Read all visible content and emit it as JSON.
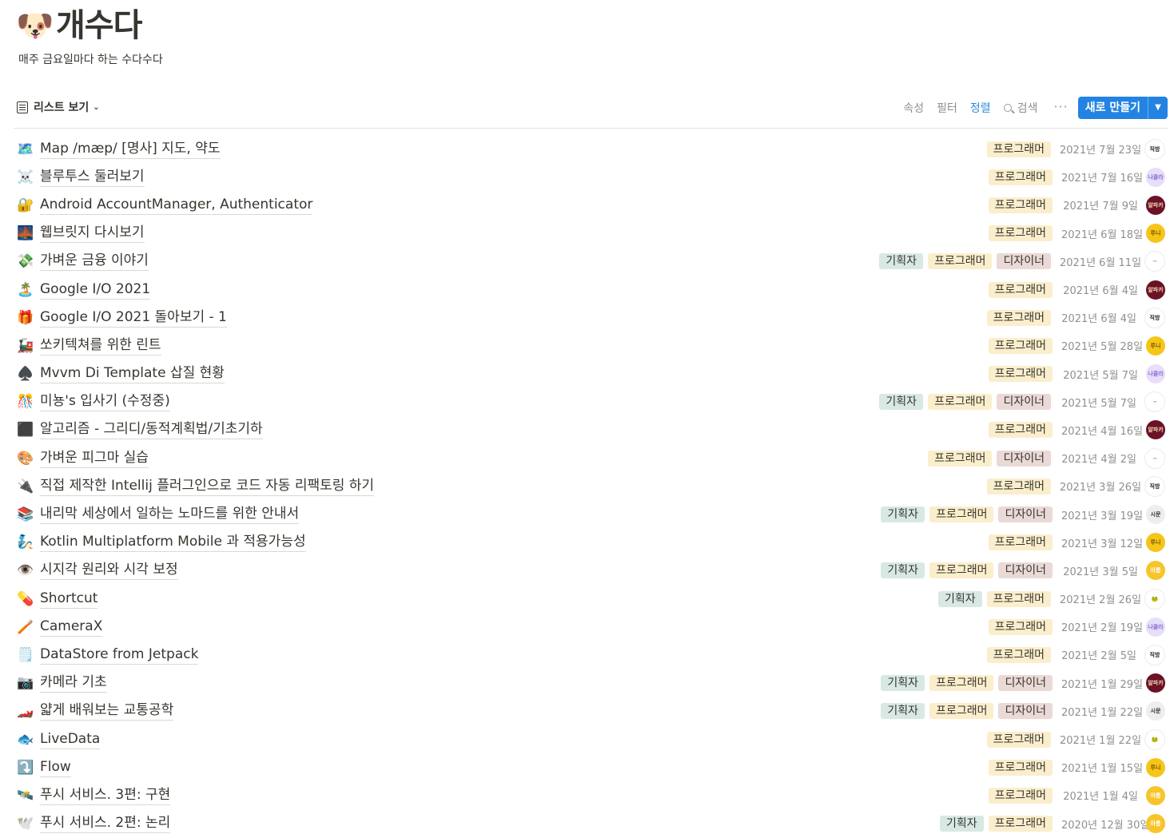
{
  "page": {
    "emoji": "🐶",
    "title": "개수다",
    "description": "매주 금요일마다 하는 수다수다"
  },
  "toolbar": {
    "view_label": "리스트 보기",
    "properties": "속성",
    "filter": "필터",
    "sort": "정렬",
    "search": "검색",
    "more": "···",
    "new_button": "새로 만들기",
    "new_dropdown": "▼"
  },
  "colors": {
    "planner": "#d8e9e4",
    "programmer": "#fbeecc",
    "designer": "#ead9d6",
    "accent": "#2383e2",
    "active_tool": "#2e8ad8"
  },
  "tag_labels": {
    "planner": "기획자",
    "programmer": "프로그래머",
    "designer": "디자이너"
  },
  "avatars": {
    "zig": {
      "label": "직방",
      "bg": "#ffffff",
      "fg": "#222222"
    },
    "na": {
      "label": "나클라",
      "bg": "#e7defa",
      "fg": "#8a6fd1"
    },
    "al": {
      "label": "알파카",
      "bg": "#6b1226",
      "fg": "#f3d9b5"
    },
    "ru": {
      "label": "루니",
      "bg": "#f5c518",
      "fg": "#7a5a00"
    },
    "sw": {
      "label": "~",
      "bg": "#ffffff",
      "fg": "#4a9bd6"
    },
    "si": {
      "label": "시문",
      "bg": "#eeeeee",
      "fg": "#333333"
    },
    "ar": {
      "label": "아름",
      "bg": "#f7c52b",
      "fg": "#ffffff"
    },
    "gr": {
      "label": "🐸",
      "bg": "#ffffff",
      "fg": "#5a8a2b"
    }
  },
  "rows": [
    {
      "icon": "🗺️",
      "title": "Map /mæp/ [명사] 지도, 약도",
      "tags": [
        "programmer"
      ],
      "date": "2021년 7월 23일",
      "avatar": "zig"
    },
    {
      "icon": "☠️",
      "title": "블루투스 둘러보기",
      "tags": [
        "programmer"
      ],
      "date": "2021년 7월 16일",
      "avatar": "na"
    },
    {
      "icon": "🔐",
      "title": "Android AccountManager, Authenticator",
      "tags": [
        "programmer"
      ],
      "date": "2021년 7월 9일",
      "avatar": "al"
    },
    {
      "icon": "🌉",
      "title": "웹브릿지 다시보기",
      "tags": [
        "programmer"
      ],
      "date": "2021년 6월 18일",
      "avatar": "ru"
    },
    {
      "icon": "💸",
      "title": "가벼운 금융 이야기",
      "tags": [
        "planner",
        "programmer",
        "designer"
      ],
      "date": "2021년 6월 11일",
      "avatar": "sw"
    },
    {
      "icon": "🏝️",
      "title": "Google I/O 2021",
      "tags": [
        "programmer"
      ],
      "date": "2021년 6월 4일",
      "avatar": "al"
    },
    {
      "icon": "🎁",
      "title": "Google I/O 2021 돌아보기 - 1",
      "tags": [
        "programmer"
      ],
      "date": "2021년 6월 4일",
      "avatar": "zig"
    },
    {
      "icon": "🚂",
      "title": "쏘키텍쳐를 위한 린트",
      "tags": [
        "programmer"
      ],
      "date": "2021년 5월 28일",
      "avatar": "ru"
    },
    {
      "icon": "♠️",
      "title": "Mvvm Di Template 삽질 현황",
      "tags": [
        "programmer"
      ],
      "date": "2021년 5월 7일",
      "avatar": "na"
    },
    {
      "icon": "🎊",
      "title": "미뇽's 입사기 (수정중)",
      "tags": [
        "planner",
        "programmer",
        "designer"
      ],
      "date": "2021년 5월 7일",
      "avatar": "sw"
    },
    {
      "icon": "⬛",
      "title": "알고리즘 - 그리디/동적계획법/기초기하",
      "tags": [
        "programmer"
      ],
      "date": "2021년 4월 16일",
      "avatar": "al"
    },
    {
      "icon": "🎨",
      "title": "가벼운 피그마 실습",
      "tags": [
        "programmer",
        "designer"
      ],
      "date": "2021년 4월 2일",
      "avatar": "sw"
    },
    {
      "icon": "🔌",
      "title": "직접 제작한 Intellij 플러그인으로 코드 자동 리팩토링 하기",
      "tags": [
        "programmer"
      ],
      "date": "2021년 3월 26일",
      "avatar": "zig"
    },
    {
      "icon": "📚",
      "title": "내리막 세상에서 일하는 노마드를 위한 안내서",
      "tags": [
        "planner",
        "programmer",
        "designer"
      ],
      "date": "2021년 3월 19일",
      "avatar": "si"
    },
    {
      "icon": "🧞",
      "title": "Kotlin Multiplatform Mobile 과 적용가능성",
      "tags": [
        "programmer"
      ],
      "date": "2021년 3월 12일",
      "avatar": "ru"
    },
    {
      "icon": "👁️",
      "title": "시지각 원리와 시각 보정",
      "tags": [
        "planner",
        "programmer",
        "designer"
      ],
      "date": "2021년 3월 5일",
      "avatar": "ar"
    },
    {
      "icon": "💊",
      "title": "Shortcut",
      "tags": [
        "planner",
        "programmer"
      ],
      "date": "2021년 2월 26일",
      "avatar": "gr"
    },
    {
      "icon": "🪥",
      "title": "CameraX",
      "tags": [
        "programmer"
      ],
      "date": "2021년 2월 19일",
      "avatar": "na"
    },
    {
      "icon": "🗒️",
      "title": "DataStore from Jetpack",
      "tags": [
        "programmer"
      ],
      "date": "2021년 2월 5일",
      "avatar": "zig"
    },
    {
      "icon": "📷",
      "title": "카메라 기초",
      "tags": [
        "planner",
        "programmer",
        "designer"
      ],
      "date": "2021년 1월 29일",
      "avatar": "al"
    },
    {
      "icon": "🏎️",
      "title": "얇게 배워보는 교통공학",
      "tags": [
        "planner",
        "programmer",
        "designer"
      ],
      "date": "2021년 1월 22일",
      "avatar": "si"
    },
    {
      "icon": "🐟",
      "title": "LiveData",
      "tags": [
        "programmer"
      ],
      "date": "2021년 1월 22일",
      "avatar": "gr"
    },
    {
      "icon": "⤵️",
      "title": "Flow",
      "tags": [
        "programmer"
      ],
      "date": "2021년 1월 15일",
      "avatar": "ru"
    },
    {
      "icon": "🛰️",
      "title": "푸시 서비스. 3편: 구현",
      "tags": [
        "programmer"
      ],
      "date": "2021년 1월 4일",
      "avatar": "ar"
    },
    {
      "icon": "🕊️",
      "title": "푸시 서비스. 2편: 논리",
      "tags": [
        "planner",
        "programmer"
      ],
      "date": "2020년 12월 30일",
      "avatar": "ar"
    }
  ]
}
